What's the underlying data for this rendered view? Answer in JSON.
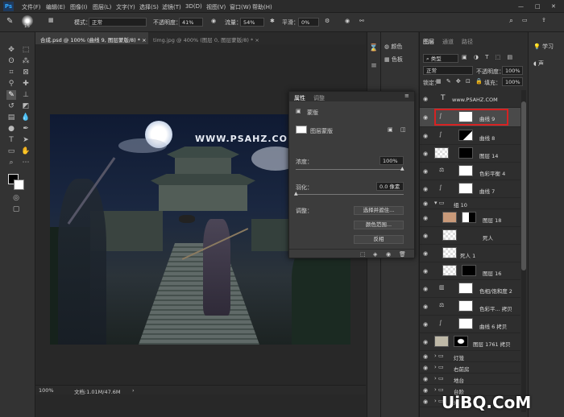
{
  "menu": [
    "文件(F)",
    "编辑(E)",
    "图像(I)",
    "图层(L)",
    "文字(Y)",
    "选择(S)",
    "滤镜(T)",
    "3D(D)",
    "视图(V)",
    "窗口(W)",
    "帮助(H)"
  ],
  "options": {
    "brush_size": "15",
    "mode_label": "模式：",
    "mode_value": "正常",
    "opacity_label": "不透明度：",
    "opacity_value": "41%",
    "flow_label": "流量：",
    "flow_value": "54%",
    "smooth_label": "平滑：",
    "smooth_value": "0%"
  },
  "tabs": [
    "合成.psd @ 100% (曲线 9, 图层蒙版/8) *",
    "timg.jpg @ 400% (图层 0, 图层蒙版/8) *"
  ],
  "canvas": {
    "watermark": "WWW.PSAHZ.COM"
  },
  "status": {
    "zoom": "100%",
    "doc": "文档:1.01M/47.6M"
  },
  "colpanel": {
    "color": "颜色",
    "swatches": "色板"
  },
  "layers": {
    "tabs": [
      "图层",
      "通道",
      "路径"
    ],
    "kind": "类型",
    "blend": "正常",
    "opacity_label": "不透明度：",
    "opacity": "100%",
    "lock_label": "锁定：",
    "fill_label": "填充：",
    "fill": "100%",
    "rows": [
      "www.PSAHZ.COM",
      "曲线 9",
      "曲线 8",
      "图层 14",
      "色彩平衡 4",
      "曲线 7",
      "组 10",
      "图层 18",
      "死人",
      "死人 1",
      "图层 16",
      "色相/饱和度 2",
      "色彩平... 拷贝",
      "曲线 6 拷贝",
      "图层 1761 拷贝",
      "灯笼",
      "右前房",
      "地台",
      "台阶",
      "地"
    ]
  },
  "properties": {
    "tabs": [
      "属性",
      "调整"
    ],
    "mask_title": "蒙版",
    "layer_mask": "图层蒙版",
    "density_label": "浓度：",
    "density": "100%",
    "feather_label": "羽化：",
    "feather": "0.0 像素",
    "refine_label": "调整：",
    "btn_select": "选择并遮住...",
    "btn_color_range": "颜色范围...",
    "btn_invert": "反相"
  },
  "right": {
    "learn": "学习",
    "sound": "声"
  },
  "logo": "UiBQ.CoM"
}
